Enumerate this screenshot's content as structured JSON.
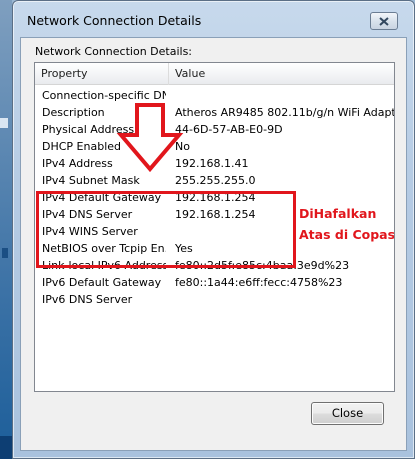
{
  "window": {
    "title": "Network Connection Details"
  },
  "dialog": {
    "subtitle": "Network Connection Details:",
    "columns": [
      "Property",
      "Value"
    ],
    "rows": [
      {
        "property": "Connection-specific DN...",
        "value": ""
      },
      {
        "property": "Description",
        "value": "Atheros AR9485 802.11b/g/n WiFi Adapt"
      },
      {
        "property": "Physical Address",
        "value": "44-6D-57-AB-E0-9D"
      },
      {
        "property": "DHCP Enabled",
        "value": "No"
      },
      {
        "property": "IPv4 Address",
        "value": "192.168.1.41"
      },
      {
        "property": "IPv4 Subnet Mask",
        "value": "255.255.255.0"
      },
      {
        "property": "IPv4 Default Gateway",
        "value": "192.168.1.254"
      },
      {
        "property": "IPv4 DNS Server",
        "value": "192.168.1.254"
      },
      {
        "property": "IPv4 WINS Server",
        "value": ""
      },
      {
        "property": "NetBIOS over Tcpip En...",
        "value": "Yes"
      },
      {
        "property": "Link-local IPv6 Address",
        "value": "fe80::2d5f:e85c:4baa:3e9d%23"
      },
      {
        "property": "IPv6 Default Gateway",
        "value": "fe80::1a44:e6ff:fecc:4758%23"
      },
      {
        "property": "IPv6 DNS Server",
        "value": ""
      }
    ],
    "close_label": "Close"
  },
  "annotation": {
    "line1": "DiHafalkan",
    "line2": "Atas di Copas",
    "color": "#e1161c"
  },
  "icons": {
    "close": "close-icon",
    "arrow": "arrow-down-icon"
  }
}
